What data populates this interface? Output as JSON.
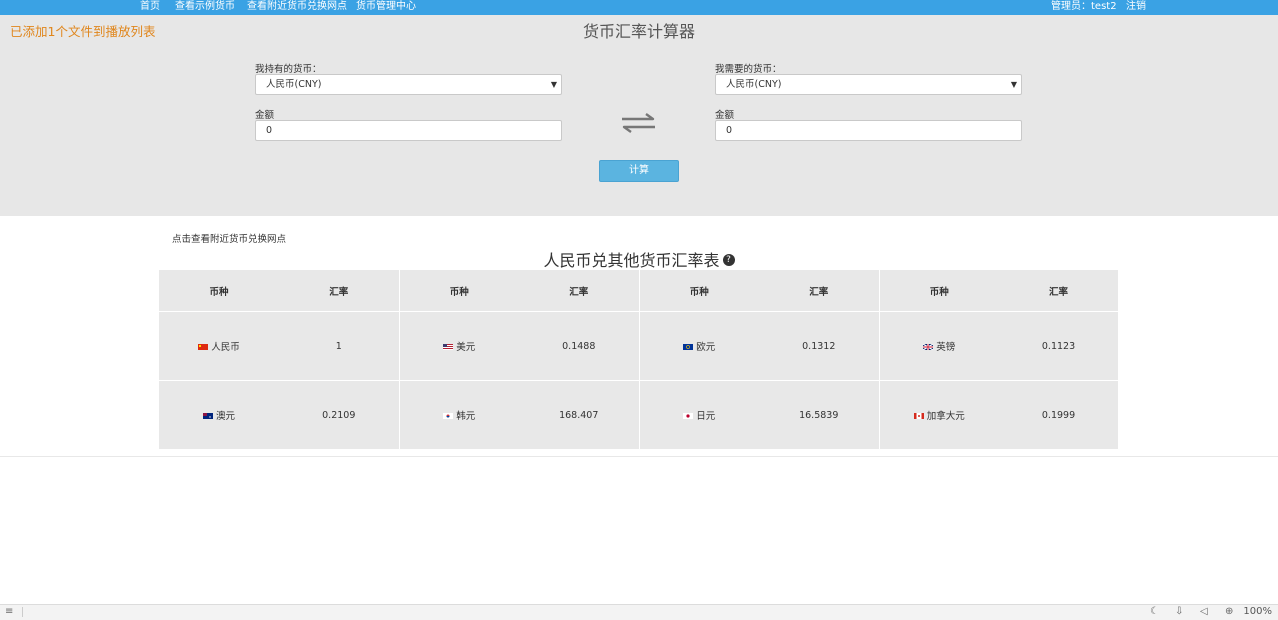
{
  "nav": {
    "items": [
      "首页",
      "查看示例货币",
      "查看附近货币兑换网点",
      "货币管理中心"
    ],
    "admin": "管理员：test2",
    "logout": "注销"
  },
  "notice": "已添加1个文件到播放列表",
  "calculator": {
    "title": "货币汇率计算器",
    "have_label": "我持有的货币：",
    "have_value": "人民币(CNY)",
    "need_label": "我需要的货币：",
    "need_value": "人民币(CNY)",
    "amount_label": "金额",
    "have_amount": "0",
    "need_amount": "0",
    "button": "计算"
  },
  "nearby_link": "点击查看附近货币兑换网点",
  "rate_table": {
    "title": "人民币兑其他货币汇率表",
    "headers": [
      "币种",
      "汇率",
      "币种",
      "汇率",
      "币种",
      "汇率",
      "币种",
      "汇率"
    ],
    "rows": [
      [
        {
          "name": "人民币",
          "rate": "1",
          "flag": "cn-flag-icon"
        },
        {
          "name": "美元",
          "rate": "0.1488",
          "flag": "us-flag-icon"
        },
        {
          "name": "欧元",
          "rate": "0.1312",
          "flag": "eu-flag-icon"
        },
        {
          "name": "英镑",
          "rate": "0.1123",
          "flag": "uk-flag-icon"
        }
      ],
      [
        {
          "name": "澳元",
          "rate": "0.2109",
          "flag": "au-flag-icon"
        },
        {
          "name": "韩元",
          "rate": "168.407",
          "flag": "kr-flag-icon"
        },
        {
          "name": "日元",
          "rate": "16.5839",
          "flag": "jp-flag-icon"
        },
        {
          "name": "加拿大元",
          "rate": "0.1999",
          "flag": "ca-flag-icon"
        }
      ]
    ]
  },
  "statusbar": {
    "zoom": "100%",
    "icons": [
      "playlist-icon",
      "moon-icon",
      "download-icon",
      "volume-icon",
      "zoom-icon"
    ]
  },
  "colors": {
    "nav_bg": "#3aa2e4",
    "calc_bg": "#e7e7e7",
    "notice": "#e0861c",
    "button": "#5bb4e0",
    "table_bg": "#e8e8e8"
  }
}
